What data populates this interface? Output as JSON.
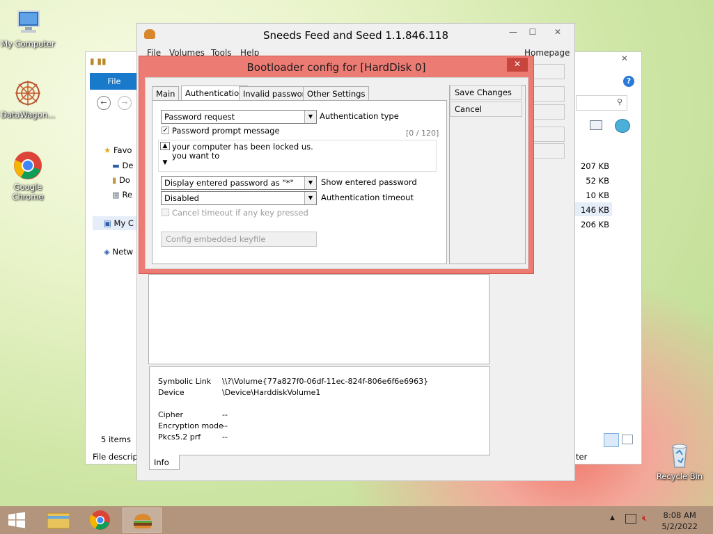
{
  "desktop": {
    "icons": [
      {
        "label": "My Computer"
      },
      {
        "label": "DataWagon..."
      },
      {
        "label": "Google Chrome"
      },
      {
        "label": "Recycle Bin"
      }
    ]
  },
  "explorer": {
    "file_tab": "File",
    "nav_items": [
      "Favo",
      "De",
      "Do",
      "Re",
      "My C",
      "Netw"
    ],
    "items_count": "5 items",
    "file_description": "File descript",
    "sizes": [
      "207 KB",
      "52 KB",
      "10 KB",
      "146 KB",
      "206 KB"
    ],
    "status_right": "ter"
  },
  "sneeds": {
    "title": "Sneeds Feed and Seed 1.1.846.118",
    "menu": [
      "File",
      "Volumes",
      "Tools",
      "Help"
    ],
    "homepage": "Homepage",
    "info_tab": "Info",
    "info": {
      "symbolic_link_label": "Symbolic Link",
      "symbolic_link_value": "\\\\?\\Volume{77a827f0-06df-11ec-824f-806e6f6e6963}",
      "device_label": "Device",
      "device_value": "\\Device\\HarddiskVolume1",
      "cipher_label": "Cipher",
      "cipher_value": "--",
      "encryption_mode_label": "Encryption mode",
      "encryption_mode_value": "--",
      "pkcs_label": "Pkcs5.2 prf",
      "pkcs_value": "--"
    }
  },
  "dialog": {
    "title": "Bootloader config for [HardDisk 0]",
    "close": "✕",
    "tabs": [
      "Main",
      "Authentication",
      "Invalid password",
      "Other Settings"
    ],
    "save_changes": "Save Changes",
    "cancel": "Cancel",
    "auth_type_value": "Password request",
    "auth_type_label": "Authentication type",
    "prompt_checkbox_label": "Password prompt message",
    "prompt_checked": true,
    "char_count": "[0 / 120]",
    "message_line1": "your computer has been locked us.",
    "message_line2": "you want to",
    "show_password_value": "Display entered password as \"*\"",
    "show_password_label": "Show entered password",
    "timeout_value": "Disabled",
    "timeout_label": "Authentication timeout",
    "cancel_timeout_label": "Cancel timeout if any key pressed",
    "config_keyfile": "Config embedded keyfile"
  },
  "taskbar": {
    "time": "8:08 AM",
    "date": "5/2/2022"
  }
}
